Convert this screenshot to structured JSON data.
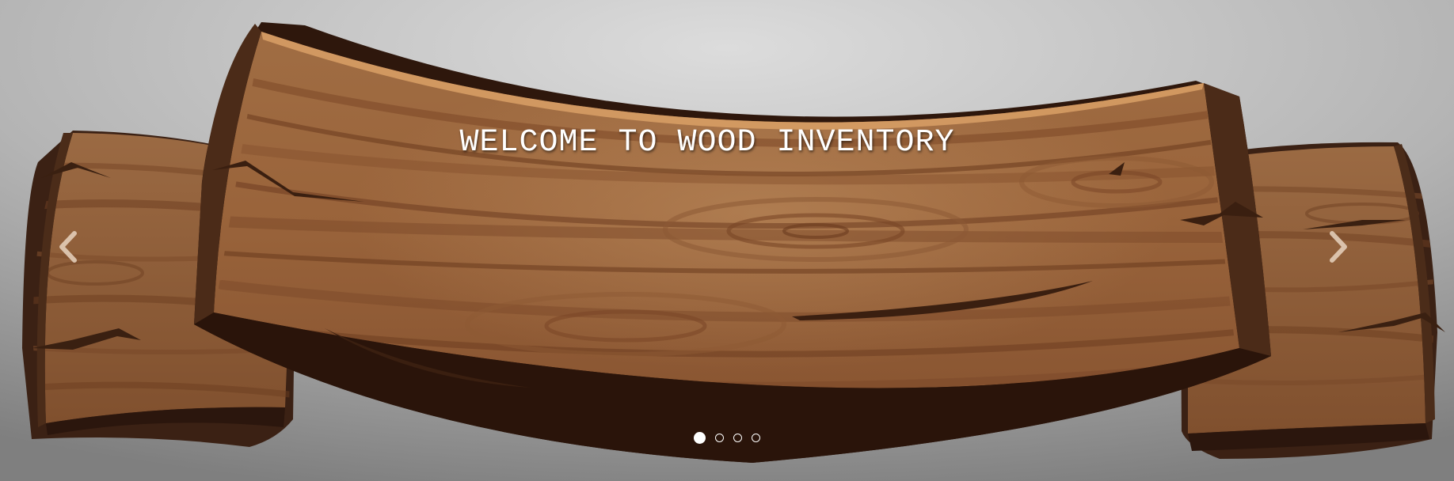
{
  "carousel": {
    "caption": "WELCOME TO WOOD INVENTORY",
    "prev_icon": "chevron-left-icon",
    "next_icon": "chevron-right-icon",
    "slide_count": 4,
    "active_slide": 1,
    "colors": {
      "background_light": "#d4d4d4",
      "background_dark": "#8c8c8c",
      "wood_light": "#b07a4c",
      "wood_mid": "#8e5a34",
      "wood_dark": "#3a2015",
      "wood_edge": "#4e2f1c",
      "highlight": "#d9a066",
      "caption_color": "#ffffff"
    }
  }
}
